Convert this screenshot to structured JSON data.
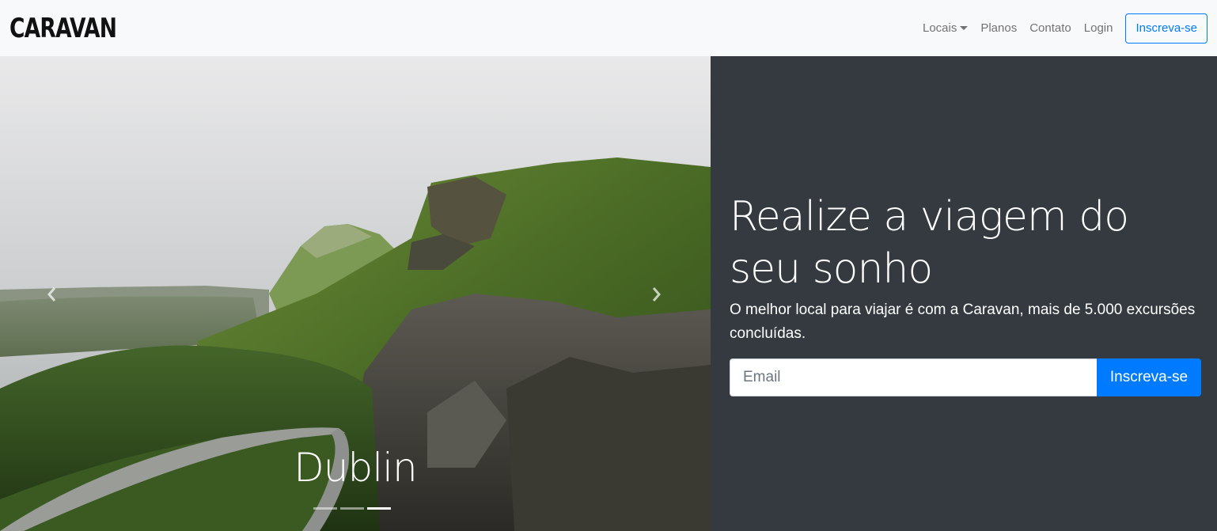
{
  "navbar": {
    "brand": "CARAVAN",
    "links": [
      {
        "label": "Locais"
      },
      {
        "label": "Planos"
      },
      {
        "label": "Contato"
      },
      {
        "label": "Login"
      }
    ],
    "cta_label": "Inscreva-se"
  },
  "carousel": {
    "caption": "Dublin",
    "slide_count": 3,
    "active_index": 2,
    "prev_icon": "chevron-left-icon",
    "next_icon": "chevron-right-icon"
  },
  "hero": {
    "headline": "Realize a viagem do seu sonho",
    "lead": "O melhor local para viajar é com a Caravan, mais de 5.000 excursões concluídas.",
    "email_placeholder": "Email",
    "submit_label": "Inscreva-se"
  },
  "colors": {
    "primary": "#007bff",
    "dark": "#343a40",
    "navbar_bg": "#f8f9fa"
  }
}
